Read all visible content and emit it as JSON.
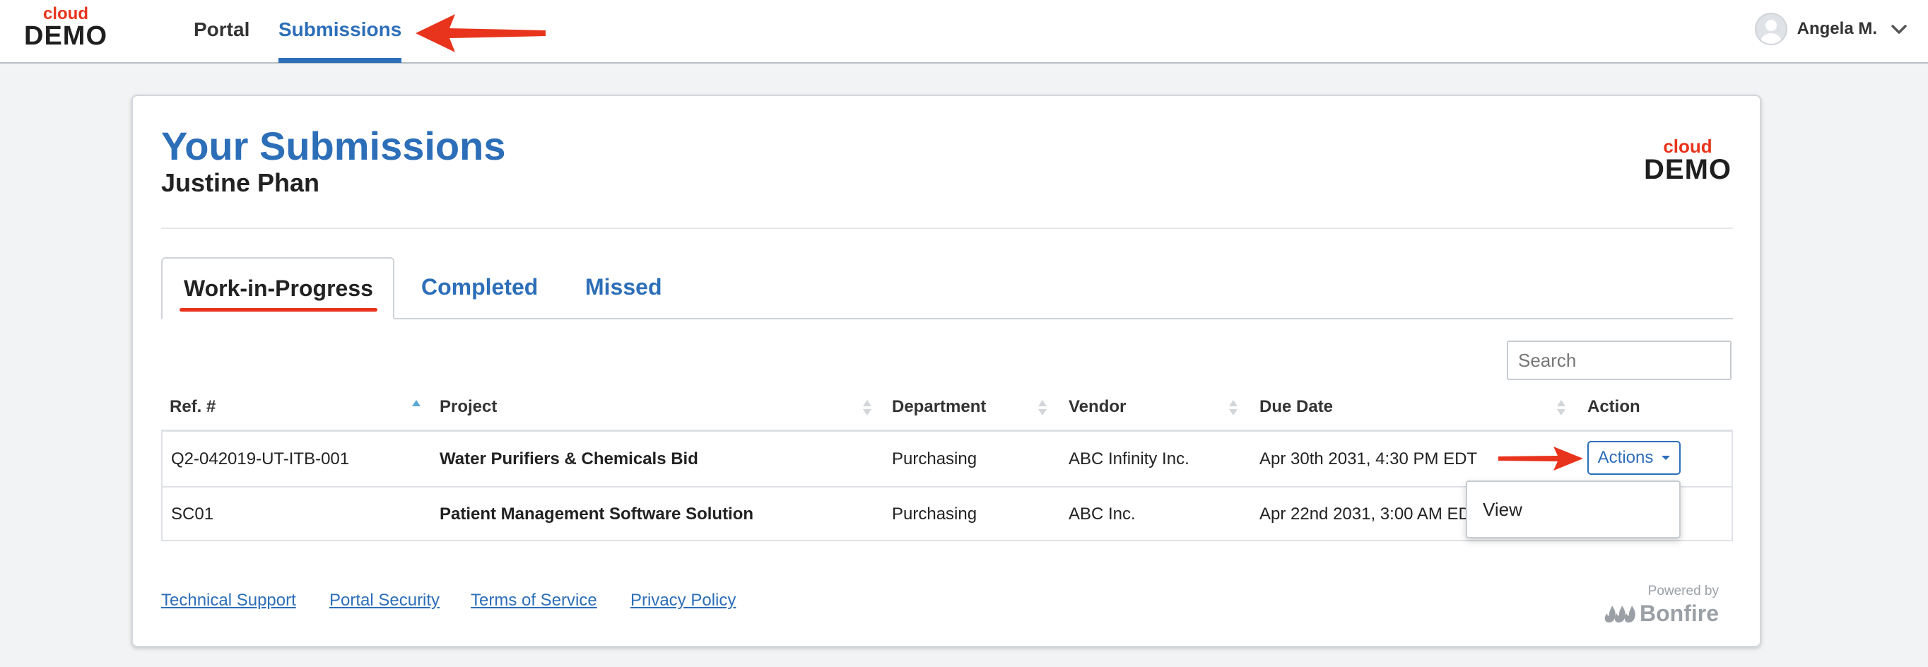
{
  "brand": {
    "cloud": "cloud",
    "demo": "DEMO"
  },
  "nav": {
    "items": [
      {
        "label": "Portal"
      },
      {
        "label": "Submissions",
        "active": true
      }
    ]
  },
  "user": {
    "name": "Angela M."
  },
  "page": {
    "title": "Your Submissions",
    "subtitle": "Justine Phan"
  },
  "tabs": [
    {
      "label": "Work-in-Progress",
      "active": true
    },
    {
      "label": "Completed"
    },
    {
      "label": "Missed"
    }
  ],
  "search": {
    "placeholder": "Search",
    "value": ""
  },
  "table": {
    "columns": [
      "Ref. #",
      "Project",
      "Department",
      "Vendor",
      "Due Date",
      "Action"
    ],
    "sort": {
      "column": "Ref. #",
      "direction": "ascending"
    },
    "rows": [
      {
        "ref": "Q2-042019-UT-ITB-001",
        "project": "Water Purifiers & Chemicals Bid",
        "department": "Purchasing",
        "vendor": "ABC Infinity Inc.",
        "due": "Apr 30th 2031, 4:30 PM EDT",
        "action": "Actions"
      },
      {
        "ref": "SC01",
        "project": "Patient Management Software Solution",
        "department": "Purchasing",
        "vendor": "ABC Inc.",
        "due": "Apr 22nd 2031, 3:00 AM EDT"
      }
    ]
  },
  "dropdown": {
    "items": [
      "View"
    ]
  },
  "footer": {
    "links": [
      "Technical Support",
      "Portal Security",
      "Terms of Service",
      "Privacy Policy"
    ],
    "powered_by": "Powered by",
    "bonfire": "Bonfire"
  },
  "colors": {
    "accent": "#2c6eb8",
    "brand_red": "#e8341c",
    "annotation": "#e8341c"
  },
  "icons": [
    "avatar-icon",
    "chevron-down-icon",
    "sort-asc-icon",
    "sort-icon",
    "caret-down-icon",
    "bonfire-logo-icon",
    "annotation-arrow-icon"
  ]
}
